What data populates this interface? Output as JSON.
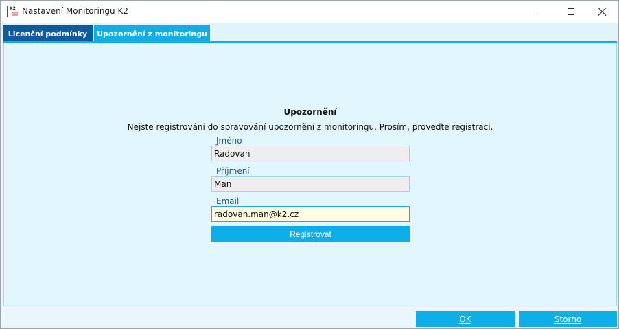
{
  "window": {
    "title": "Nastavení Monitoringu K2",
    "app_icon_text": "K2"
  },
  "tabs": [
    {
      "label": "Licenční podmínky",
      "active": false
    },
    {
      "label": "Upozornění z monitoringu",
      "active": true
    }
  ],
  "content": {
    "heading": "Upozornění",
    "message": "Nejste registrováni do spravování upozornění z monitoringu. Prosím, proveďte registraci.",
    "fields": [
      {
        "label": "Jméno",
        "value": "Radovan"
      },
      {
        "label": "Příjmení",
        "value": "Man"
      },
      {
        "label": "Email",
        "value": "radovan.man@k2.cz"
      }
    ],
    "register_label": "Registrovat"
  },
  "footer": {
    "ok_label": "OK",
    "cancel_label": "Storno"
  },
  "colors": {
    "accent": "#0eaee8",
    "tab_inactive": "#0e5a9e",
    "panel_bg": "#e2f6fd",
    "email_bg": "#fffde2"
  }
}
